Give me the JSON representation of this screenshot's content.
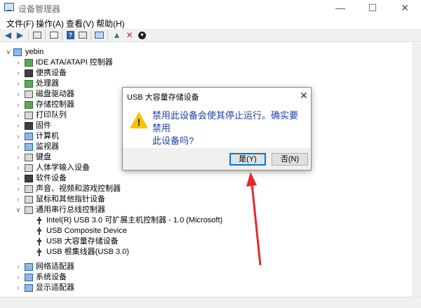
{
  "window": {
    "title": "设备管理器",
    "minimize": "—",
    "maximize": "☐",
    "close": "✕"
  },
  "menu": [
    "文件(F)",
    "操作(A)",
    "查看(V)",
    "帮助(H)"
  ],
  "tree": {
    "root": "yebin",
    "items": [
      {
        "label": "IDE ATA/ATAPI 控制器",
        "icon": "ide-controller-icon",
        "expanded": false
      },
      {
        "label": "便携设备",
        "icon": "portable-device-icon",
        "expanded": false
      },
      {
        "label": "处理器",
        "icon": "processor-icon",
        "expanded": false
      },
      {
        "label": "磁盘驱动器",
        "icon": "disk-drive-icon",
        "expanded": false
      },
      {
        "label": "存储控制器",
        "icon": "storage-controller-icon",
        "expanded": false
      },
      {
        "label": "打印队列",
        "icon": "printer-icon",
        "expanded": false
      },
      {
        "label": "固件",
        "icon": "firmware-icon",
        "expanded": false
      },
      {
        "label": "计算机",
        "icon": "computer-icon",
        "expanded": false
      },
      {
        "label": "监视器",
        "icon": "monitor-icon",
        "expanded": false
      },
      {
        "label": "键盘",
        "icon": "keyboard-icon",
        "expanded": false
      },
      {
        "label": "人体学输入设备",
        "icon": "hid-icon",
        "expanded": false
      },
      {
        "label": "软件设备",
        "icon": "software-device-icon",
        "expanded": false
      },
      {
        "label": "声音、视频和游戏控制器",
        "icon": "sound-icon",
        "expanded": false
      },
      {
        "label": "鼠标和其他指针设备",
        "icon": "mouse-icon",
        "expanded": false
      },
      {
        "label": "通用串行总线控制器",
        "icon": "usb-controller-icon",
        "expanded": true
      },
      {
        "label": "Intel(R) USB 3.0 可扩展主机控制器 - 1.0 (Microsoft)",
        "icon": "usb-icon",
        "child": true
      },
      {
        "label": "USB Composite Device",
        "icon": "usb-icon",
        "child": true
      },
      {
        "label": "USB 大容量存储设备",
        "icon": "usb-icon",
        "child": true
      },
      {
        "label": "USB 根集线器(USB 3.0)",
        "icon": "usb-icon",
        "child": true
      },
      {
        "label": "网络适配器",
        "icon": "network-adapter-icon",
        "expanded": false
      },
      {
        "label": "系统设备",
        "icon": "system-device-icon",
        "expanded": false
      },
      {
        "label": "显示适配器",
        "icon": "display-adapter-icon",
        "expanded": false
      }
    ]
  },
  "dialog": {
    "title": "USB 大容量存储设备",
    "close": "✕",
    "message_line1": "禁用此设备会使其停止运行。确实要禁用",
    "message_line2": "此设备吗?",
    "yes_label": "是(Y)",
    "no_label": "否(N)"
  },
  "colors": {
    "message": "#1f3fa8",
    "arrow": "#e8262a",
    "warning": "#f5c400",
    "focus": "#0078d7"
  }
}
